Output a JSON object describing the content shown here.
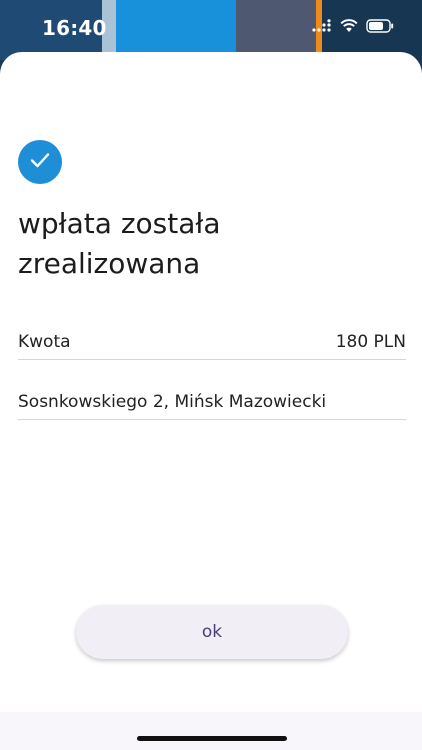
{
  "status_bar": {
    "time": "16:40",
    "icons": [
      "cellular-signal-icon",
      "wifi-icon",
      "battery-icon"
    ]
  },
  "colors": {
    "accent": "#1e8fd6",
    "button_text": "#4a3d7a",
    "button_bg": "#f1eef5"
  },
  "confirmation": {
    "icon": "checkmark-icon",
    "title": "wpłata została zrealizowana"
  },
  "details": {
    "amount_label": "Kwota",
    "amount_value": "180 PLN",
    "address": "Sosnkowskiego 2, Mińsk Mazowiecki"
  },
  "actions": {
    "ok_label": "ok"
  }
}
